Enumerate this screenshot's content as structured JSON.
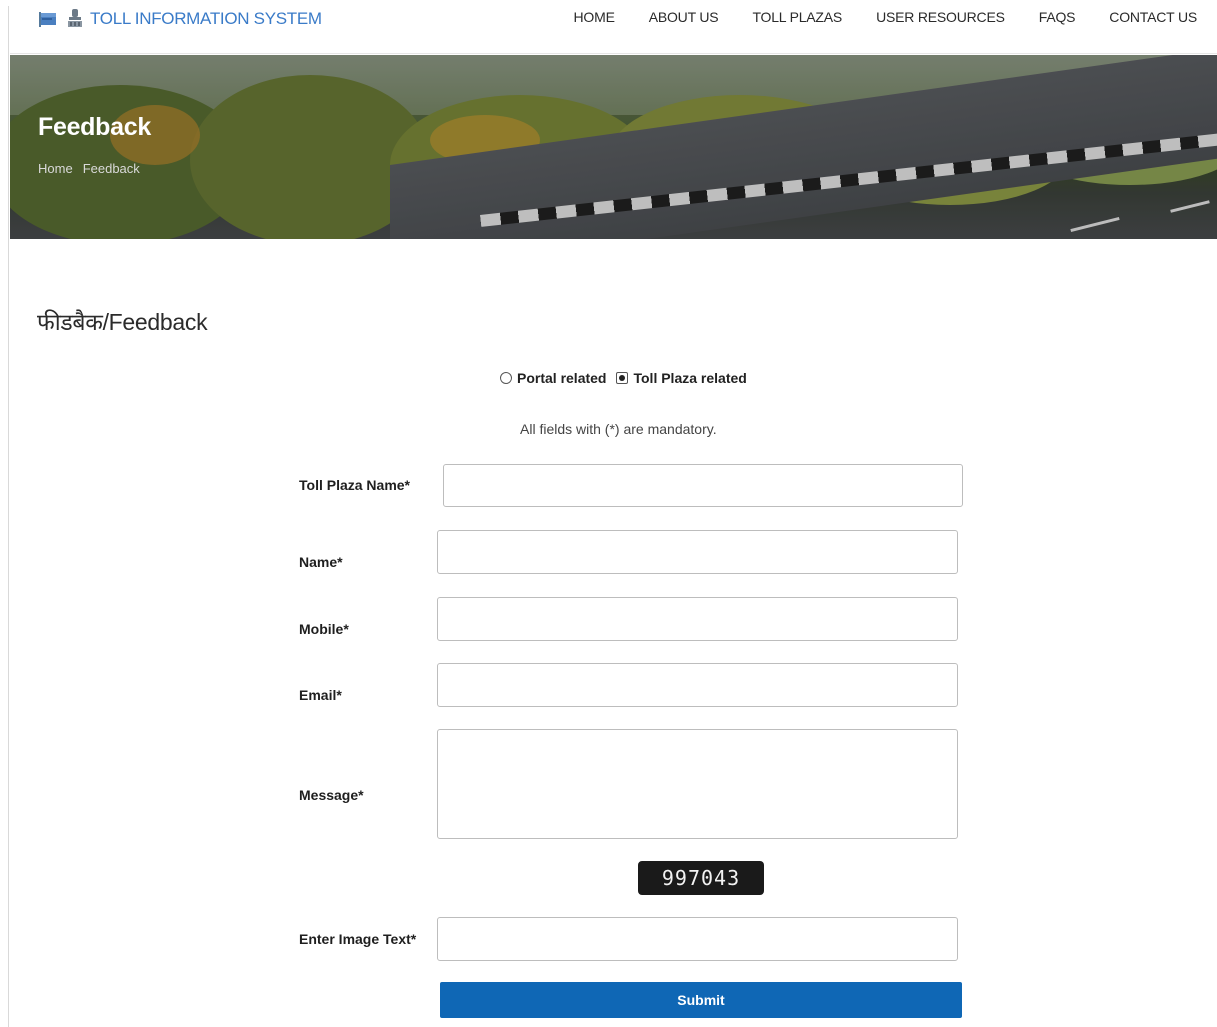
{
  "header": {
    "logo_text": "TOLL INFORMATION SYSTEM",
    "nav": [
      "HOME",
      "ABOUT US",
      "TOLL PLAZAS",
      "USER RESOURCES",
      "FAQS",
      "CONTACT US"
    ]
  },
  "banner": {
    "title": "Feedback",
    "breadcrumb": [
      "Home",
      "Feedback"
    ]
  },
  "page_title": "फीडबैक/Feedback",
  "feedback_type": {
    "options": [
      "Portal related",
      "Toll Plaza related"
    ],
    "selected": "Toll Plaza related"
  },
  "mandatory_note": "All fields with (*) are mandatory.",
  "form": {
    "toll_plaza_name_label": "Toll Plaza Name*",
    "name_label": "Name*",
    "mobile_label": "Mobile*",
    "email_label": "Email*",
    "message_label": "Message*",
    "captcha_text": "997043",
    "image_text_label": "Enter Image Text*",
    "submit_label": "Submit"
  },
  "colors": {
    "accent": "#0f67b5",
    "logo_text": "#3a7bc8"
  }
}
